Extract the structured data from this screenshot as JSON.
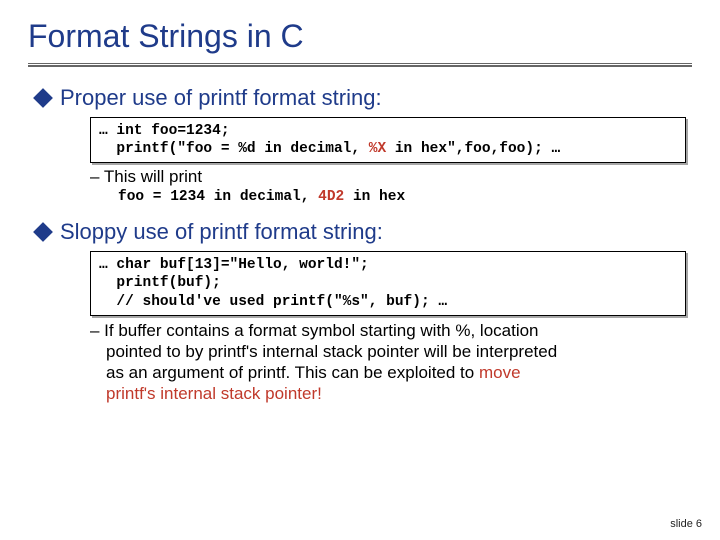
{
  "title": "Format Strings in C",
  "bullet1": "Proper use of printf format string:",
  "code1_l1": "… int foo=1234;",
  "code1_l2a": "  printf(\"foo = %d in decimal, ",
  "code1_l2_hot": "%X",
  "code1_l2b": " in hex\",foo,foo); …",
  "sub1": "– This will print",
  "output_a": "foo = 1234 in decimal, ",
  "output_hot": "4D2",
  "output_b": " in hex",
  "bullet2": "Sloppy use of printf format string:",
  "code2_l1": "… char buf[13]=\"Hello, world!\";",
  "code2_l2": "  printf(buf);",
  "code2_l3": "  // should've used printf(\"%s\", buf); …",
  "sub2_lead": "– If buffer contains a format symbol starting with %, location",
  "sub2_line2": "pointed to by printf's internal stack pointer will be interpreted",
  "sub2_line3a": "as an argument of printf.  This can be exploited to ",
  "sub2_line3_hot": "move",
  "sub2_line4_hot": "printf's internal stack pointer!",
  "footer": "slide 6"
}
